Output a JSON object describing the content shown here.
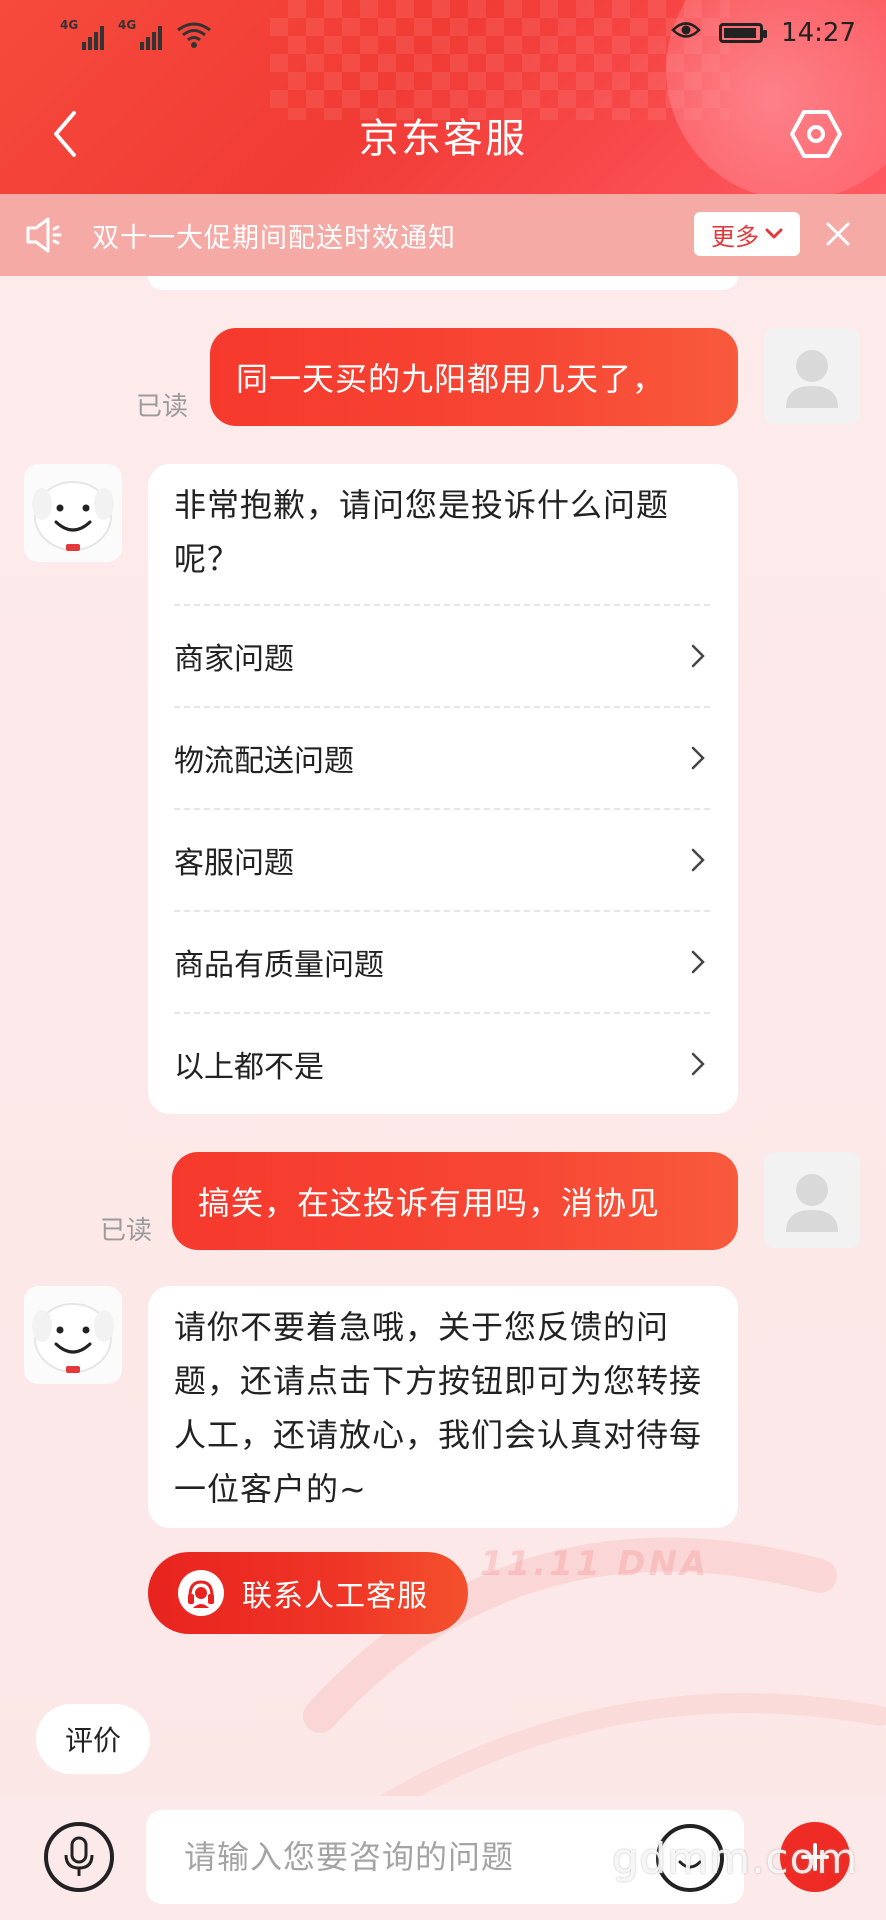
{
  "status_bar": {
    "signal1": "4G",
    "signal2": "4G",
    "time": "14:27"
  },
  "header": {
    "title": "京东客服"
  },
  "notice": {
    "text": "双十一大促期间配送时效通知",
    "more_label": "更多"
  },
  "messages": [
    {
      "from": "user",
      "text": "同一天买的九阳都用几天了，",
      "read": "已读"
    },
    {
      "from": "bot",
      "text": "非常抱歉，请问您是投诉什么问题呢？",
      "options": [
        "商家问题",
        "物流配送问题",
        "客服问题",
        "商品有质量问题",
        "以上都不是"
      ]
    },
    {
      "from": "user",
      "text": "搞笑，在这投诉有用吗，消协见",
      "read": "已读"
    },
    {
      "from": "bot",
      "text": "请你不要着急哦，关于您反馈的问题，还请点击下方按钮即可为您转接人工，还请放心，我们会认真对待每一位客户的~"
    }
  ],
  "contact_button": "联系人工客服",
  "rate_button": "评价",
  "decor": {
    "dna": "11.11 DNA"
  },
  "input": {
    "placeholder": "请输入您要咨询的问题"
  },
  "watermark": "gdmm.com",
  "colors": {
    "brand_red": "#f13b35",
    "notice_bg": "#f6aaa6",
    "page_bg": "#fdeaea"
  }
}
